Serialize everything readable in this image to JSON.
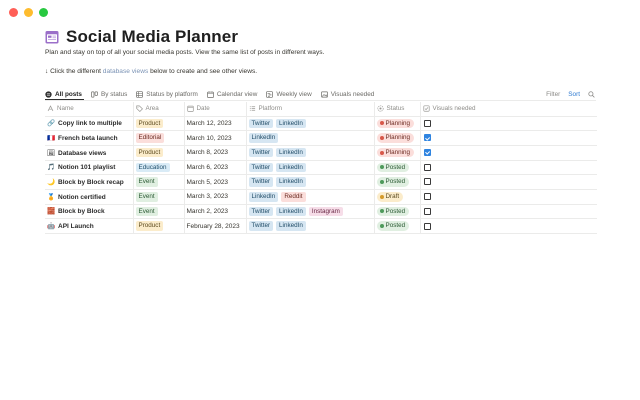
{
  "page": {
    "title": "Social Media Planner",
    "title_icon": "calendar-icon",
    "description": "Plan and stay on top of all your social media posts. View the same list of posts in different ways.",
    "hint_prefix": "↓ Click the different ",
    "hint_link": "database views",
    "hint_suffix": " below to create and see other views."
  },
  "tabs": [
    {
      "label": "All posts",
      "icon": "list-icon",
      "active": true
    },
    {
      "label": "By status",
      "icon": "board-icon",
      "active": false
    },
    {
      "label": "Status by platform",
      "icon": "table-icon",
      "active": false
    },
    {
      "label": "Calendar view",
      "icon": "calendar-icon",
      "active": false
    },
    {
      "label": "Weekly view",
      "icon": "timeline-icon",
      "active": false
    },
    {
      "label": "Visuals needed",
      "icon": "gallery-icon",
      "active": false
    }
  ],
  "toolbar": {
    "filter_label": "Filter",
    "sort_label": "Sort",
    "search_icon": "search-icon"
  },
  "columns": {
    "name": "Name",
    "area": "Area",
    "date": "Date",
    "platform": "Platform",
    "status": "Status",
    "visuals": "Visuals needed"
  },
  "rows": [
    {
      "emoji": "🔗",
      "name": "Copy link to multiple",
      "area": "Product",
      "date": "March 12, 2023",
      "platforms": [
        "Twitter",
        "LinkedIn"
      ],
      "status": "Planning",
      "visuals": false
    },
    {
      "emoji": "🇫🇷",
      "name": "French beta launch",
      "area": "Editorial",
      "date": "March 10, 2023",
      "platforms": [
        "LinkedIn"
      ],
      "status": "Planning",
      "visuals": true
    },
    {
      "emoji": "🖼",
      "name": "Database views",
      "area": "Product",
      "date": "March 8, 2023",
      "platforms": [
        "Twitter",
        "LinkedIn"
      ],
      "status": "Planning",
      "visuals": true
    },
    {
      "emoji": "🎵",
      "name": "Notion 101 playlist",
      "area": "Education",
      "date": "March 6, 2023",
      "platforms": [
        "Twitter",
        "LinkedIn"
      ],
      "status": "Posted",
      "visuals": false
    },
    {
      "emoji": "🌙",
      "name": "Block by Block recap",
      "area": "Event",
      "date": "March 5, 2023",
      "platforms": [
        "Twitter",
        "LinkedIn"
      ],
      "status": "Posted",
      "visuals": false
    },
    {
      "emoji": "🏅",
      "name": "Notion certified",
      "area": "Event",
      "date": "March 3, 2023",
      "platforms": [
        "LinkedIn",
        "Reddit"
      ],
      "status": "Draft",
      "visuals": false
    },
    {
      "emoji": "🧱",
      "name": "Block by Block",
      "area": "Event",
      "date": "March 2, 2023",
      "platforms": [
        "Twitter",
        "LinkedIn",
        "Instagram"
      ],
      "status": "Posted",
      "visuals": false
    },
    {
      "emoji": "🤖",
      "name": "API Launch",
      "area": "Product",
      "date": "February 28, 2023",
      "platforms": [
        "Twitter",
        "LinkedIn"
      ],
      "status": "Posted",
      "visuals": false
    }
  ],
  "colors": {
    "accent": "#2f84e0",
    "planning": "#fbdedb",
    "posted": "#e0efe1",
    "draft": "#fbeccb"
  }
}
